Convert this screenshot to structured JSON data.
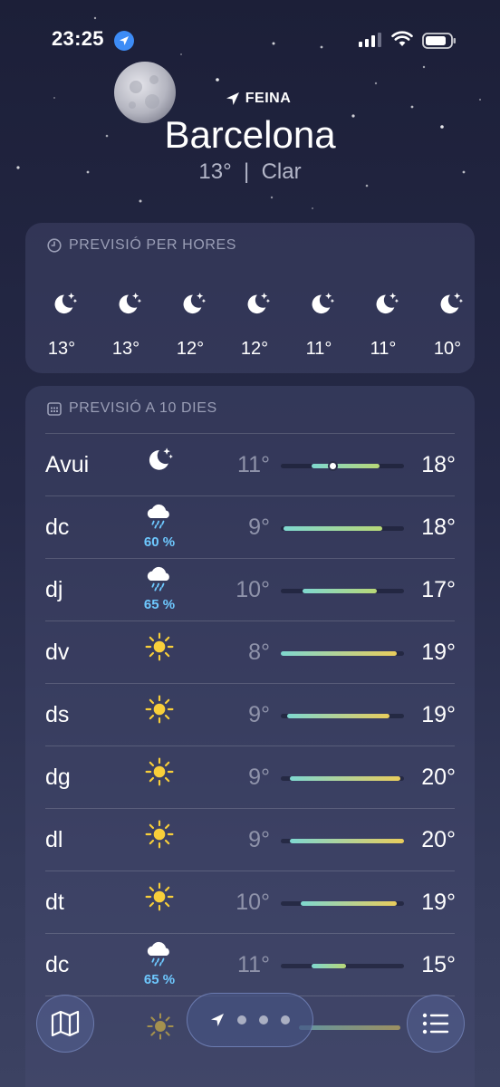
{
  "status": {
    "time": "23:25"
  },
  "location": {
    "label": "FEINA",
    "city": "Barcelona",
    "temp": "13°",
    "separator": "|",
    "condition": "Clar"
  },
  "hourly": {
    "title": "PREVISIÓ PER HORES",
    "items": [
      {
        "icon": "moon-stars-icon",
        "temp": "13°"
      },
      {
        "icon": "moon-stars-icon",
        "temp": "13°"
      },
      {
        "icon": "moon-stars-icon",
        "temp": "12°"
      },
      {
        "icon": "moon-stars-icon",
        "temp": "12°"
      },
      {
        "icon": "moon-stars-icon",
        "temp": "11°"
      },
      {
        "icon": "moon-stars-icon",
        "temp": "11°"
      },
      {
        "icon": "moon-stars-icon",
        "temp": "10°"
      }
    ]
  },
  "daily": {
    "title": "PREVISIÓ A 10 DIES",
    "days": [
      {
        "name": "Avui",
        "icon": "moon-stars-icon",
        "precip": "",
        "low": "11°",
        "high": "18°",
        "range": [
          0.25,
          0.8
        ],
        "current": 0.42
      },
      {
        "name": "dc",
        "icon": "rain-cloud-icon",
        "precip": "60 %",
        "low": "9°",
        "high": "18°",
        "range": [
          0.02,
          0.82
        ]
      },
      {
        "name": "dj",
        "icon": "rain-cloud-icon",
        "precip": "65 %",
        "low": "10°",
        "high": "17°",
        "range": [
          0.18,
          0.78
        ]
      },
      {
        "name": "dv",
        "icon": "sun-icon",
        "precip": "",
        "low": "8°",
        "high": "19°",
        "range": [
          0.0,
          0.94
        ]
      },
      {
        "name": "ds",
        "icon": "sun-icon",
        "precip": "",
        "low": "9°",
        "high": "19°",
        "range": [
          0.05,
          0.88
        ]
      },
      {
        "name": "dg",
        "icon": "sun-icon",
        "precip": "",
        "low": "9°",
        "high": "20°",
        "range": [
          0.07,
          0.97
        ]
      },
      {
        "name": "dl",
        "icon": "sun-icon",
        "precip": "",
        "low": "9°",
        "high": "20°",
        "range": [
          0.07,
          1.0
        ]
      },
      {
        "name": "dt",
        "icon": "sun-icon",
        "precip": "",
        "low": "10°",
        "high": "19°",
        "range": [
          0.16,
          0.94
        ]
      },
      {
        "name": "dc",
        "icon": "rain-cloud-icon",
        "precip": "65 %",
        "low": "11°",
        "high": "15°",
        "range": [
          0.25,
          0.53
        ]
      }
    ]
  },
  "toolbar": {
    "left_icon": "map-icon",
    "right_icon": "list-icon",
    "pages": 4
  },
  "colors": {
    "bar_cool": "#7fd8d0",
    "bar_warm": "#e9cd5c",
    "precip": "#6ec9ff",
    "sun": "#f8cf3a"
  }
}
